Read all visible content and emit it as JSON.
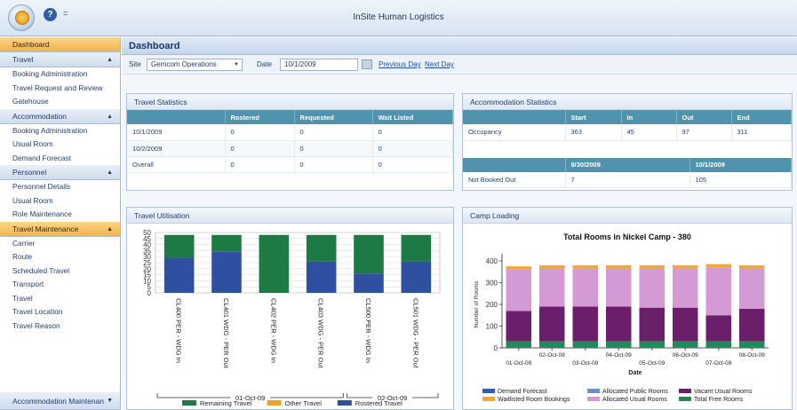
{
  "window": {
    "title": "InSite Human Logistics",
    "qa_glyph": "="
  },
  "sidebar": {
    "sections": [
      {
        "label": "Dashboard",
        "items": []
      },
      {
        "label": "Travel",
        "items": [
          "Booking Administration",
          "Travel Request and Review",
          "Gatehouse"
        ]
      },
      {
        "label": "Accommodation",
        "items": [
          "Booking Administration",
          "Usual Room",
          "Demand Forecast"
        ]
      },
      {
        "label": "Personnel",
        "items": [
          "Personnel Details",
          "Usual Room",
          "Role Maintenance"
        ]
      },
      {
        "label": "Travel Maintenance",
        "items": [
          "Carrier",
          "Route",
          "Scheduled Travel",
          "Transport",
          "Travel",
          "Travel Location",
          "Travel Reason"
        ]
      }
    ],
    "bottom": "Accommodation Maintenan"
  },
  "main": {
    "title": "Dashboard",
    "filters": {
      "site_label": "Site",
      "site_value": "Gemcom Operations",
      "date_label": "Date",
      "date_value": "10/1/2009",
      "prev": "Previous Day",
      "next": "Next Day"
    }
  },
  "travel_stats": {
    "title": "Travel Statistics",
    "headers": [
      "",
      "Rostered",
      "Requested",
      "Wait Listed"
    ],
    "rows": [
      [
        "10/1/2009",
        "0",
        "0",
        "0"
      ],
      [
        "10/2/2009",
        "0",
        "0",
        "0"
      ],
      [
        "Overall",
        "0",
        "0",
        "0"
      ]
    ]
  },
  "accom_stats": {
    "title": "Accommodation Statistics",
    "headers": [
      "",
      "Start",
      "In",
      "Out",
      "End"
    ],
    "rows": [
      [
        "Occupancy",
        "363",
        "45",
        "97",
        "311"
      ]
    ],
    "headers2": [
      "",
      "9/30/2009",
      "10/1/2009"
    ],
    "rows2": [
      [
        "Not Booked Out",
        "7",
        "105"
      ]
    ]
  },
  "travel_util": {
    "title": "Travel Utilisation"
  },
  "camp_loading": {
    "title": "Camp Loading"
  },
  "colors": {
    "remaining": "#1e7a45",
    "other": "#f0a030",
    "rostered": "#2f4fa0",
    "demand": "#3a58a8",
    "allocated_public": "#6f8fc6",
    "vacant_usual": "#6b1f6b",
    "waitlisted": "#f4a732",
    "allocated_usual": "#d49ad6",
    "total_free": "#1f8a5a"
  },
  "chart_data": [
    {
      "type": "bar",
      "stacked": true,
      "title": "",
      "categories": [
        "CL400 PER - WDG In",
        "CL401 WDG - PER Out",
        "CL402 PER - WDG In",
        "CL403 WDG - PER Out",
        "CL500 PER - WDG In",
        "CL501 WDG - PER Out"
      ],
      "groups": [
        {
          "label": "01-Oct-09"
        },
        {
          "label": "02-Oct-09"
        }
      ],
      "series": [
        {
          "name": "Rostered Travel",
          "values": [
            29,
            34,
            0,
            26,
            16,
            26
          ]
        },
        {
          "name": "Other Travel",
          "values": [
            0,
            0,
            0,
            0,
            0,
            0
          ]
        },
        {
          "name": "Remaining Travel",
          "values": [
            19,
            14,
            48,
            22,
            32,
            22
          ]
        }
      ],
      "ylim": [
        0,
        50
      ],
      "yticks": [
        0,
        5,
        10,
        15,
        20,
        25,
        30,
        35,
        40,
        45,
        50
      ],
      "legend_order": [
        "Remaining Travel",
        "Other Travel",
        "Rostered Travel"
      ],
      "grid": true,
      "legend_position": "bottom"
    },
    {
      "type": "bar",
      "stacked": true,
      "title": "Total Rooms in Nickel Camp - 380",
      "xlabel": "Date",
      "ylabel": "Number of Rooms",
      "categories": [
        "01-Oct-09",
        "02-Oct-09",
        "03-Oct-09",
        "04-Oct-09",
        "05-Oct-09",
        "06-Oct-09",
        "07-Oct-09",
        "08-Oct-09"
      ],
      "series": [
        {
          "name": "Total Free Rooms",
          "values": [
            30,
            30,
            30,
            30,
            30,
            30,
            30,
            30
          ]
        },
        {
          "name": "Vacant Usual Rooms",
          "values": [
            140,
            160,
            160,
            160,
            155,
            155,
            120,
            150
          ]
        },
        {
          "name": "Allocated Usual Rooms",
          "values": [
            190,
            175,
            175,
            175,
            180,
            180,
            220,
            185
          ]
        },
        {
          "name": "Waitlisted Room Bookings",
          "values": [
            15,
            15,
            15,
            15,
            15,
            15,
            15,
            15
          ]
        }
      ],
      "legend": [
        "Demand Forecast",
        "Allocated Public Rooms",
        "Vacant Usual Rooms",
        "Waitlisted Room Bookings",
        "Allocated Usual Rooms",
        "Total Free Rooms"
      ],
      "ylim": [
        0,
        400
      ],
      "yticks": [
        0,
        100,
        200,
        300,
        400
      ],
      "legend_position": "bottom"
    }
  ]
}
